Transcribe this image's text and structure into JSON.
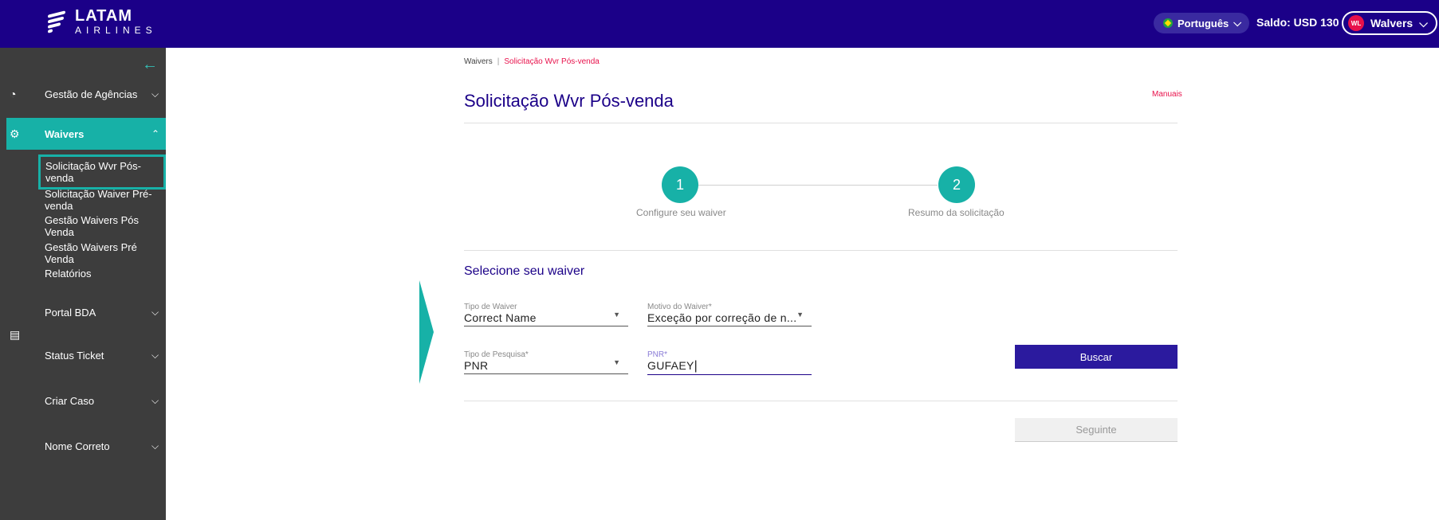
{
  "topbar": {
    "logo_main": "LATAM",
    "logo_sub": "AIRLINES",
    "language": "Português",
    "saldo": "Saldo: USD 130",
    "user_initials": "WL",
    "user_name": "Walvers"
  },
  "sidebar": {
    "items": [
      {
        "label": "Gestão de Agências"
      },
      {
        "label": "Waivers"
      },
      {
        "label": "Portal BDA"
      },
      {
        "label": "Status Ticket"
      },
      {
        "label": "Criar Caso"
      },
      {
        "label": "Nome Correto"
      }
    ],
    "waivers_sub": [
      {
        "label": "Solicitação Wvr Pós-venda"
      },
      {
        "label": "Solicitação Waiver Pré-venda"
      },
      {
        "label": "Gestão Waivers Pós Venda"
      },
      {
        "label": "Gestão Waivers Pré Venda"
      },
      {
        "label": "Relatórios"
      }
    ]
  },
  "breadcrumb": {
    "root": "Waivers",
    "current": "Solicitação Wvr Pós-venda"
  },
  "page": {
    "title": "Solicitação Wvr Pós-venda",
    "manuals": "Manuais"
  },
  "stepper": [
    {
      "number": "1",
      "label": "Configure seu waiver"
    },
    {
      "number": "2",
      "label": "Resumo da solicitação"
    }
  ],
  "form": {
    "section_title": "Selecione seu waiver",
    "tipo_waiver": {
      "label": "Tipo de Waiver",
      "value": "Correct Name"
    },
    "motivo_waiver": {
      "label": "Motivo do Waiver*",
      "value": "Exceção por correção de n..."
    },
    "tipo_pesquisa": {
      "label": "Tipo de Pesquisa*",
      "value": "PNR"
    },
    "pnr": {
      "label": "PNR*",
      "value": "GUFAEY"
    },
    "buscar_label": "Buscar",
    "seguinte_label": "Seguinte"
  },
  "colors": {
    "brand": "#1b0088",
    "accent": "#17b1a7",
    "highlight": "#e8114b"
  }
}
